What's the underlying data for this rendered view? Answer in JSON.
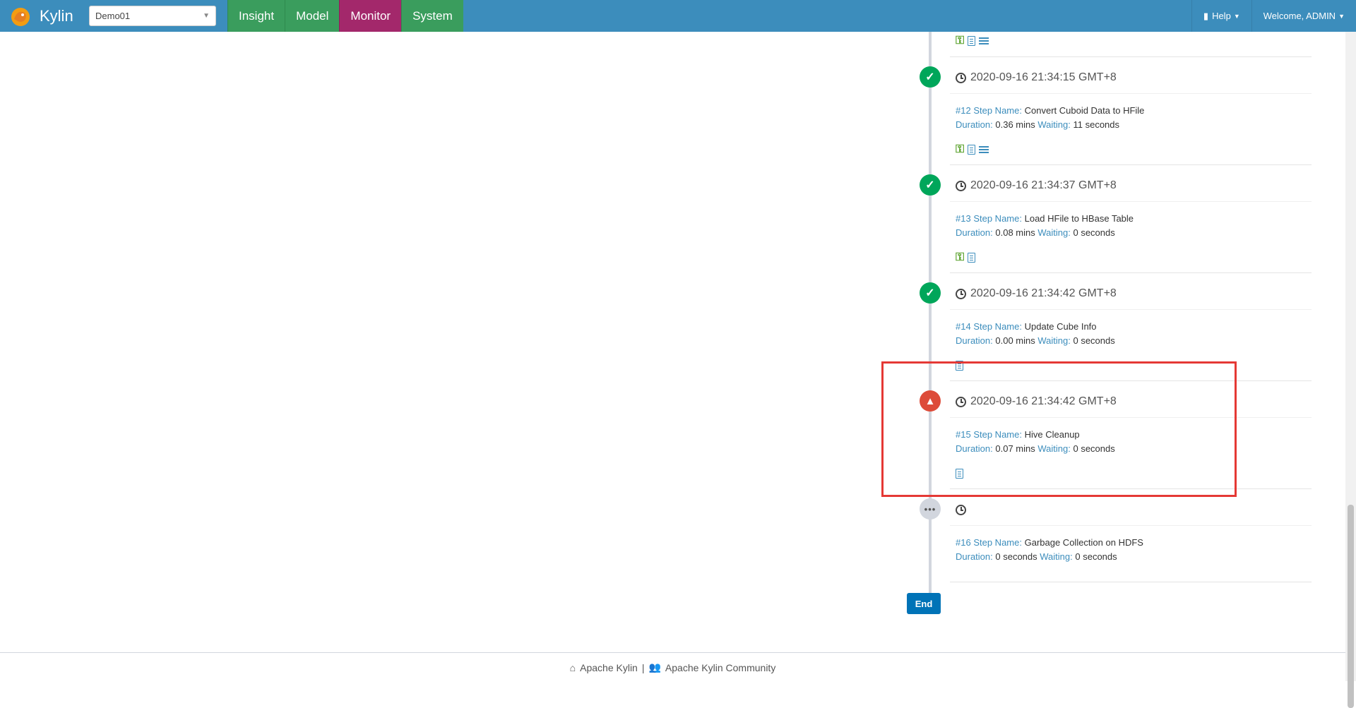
{
  "app": {
    "name": "Kylin"
  },
  "project": {
    "selected": "Demo01"
  },
  "nav": {
    "tabs": [
      {
        "label": "Insight"
      },
      {
        "label": "Model"
      },
      {
        "label": "Monitor"
      },
      {
        "label": "System"
      }
    ],
    "active_tab": "Monitor",
    "help_label": "Help",
    "welcome_label": "Welcome, ADMIN"
  },
  "labels": {
    "step_name": "Step Name:",
    "duration": "Duration:",
    "waiting": "Waiting:"
  },
  "steps": [
    {
      "number": "#12",
      "time": "2020-09-16 21:34:15 GMT+8",
      "name": "Convert Cuboid Data to HFile",
      "duration": "0.36 mins",
      "waiting": "11 seconds",
      "status": "success"
    },
    {
      "number": "#13",
      "time": "2020-09-16 21:34:37 GMT+8",
      "name": "Load HFile to HBase Table",
      "duration": "0.08 mins",
      "waiting": "0 seconds",
      "status": "success"
    },
    {
      "number": "#14",
      "time": "2020-09-16 21:34:42 GMT+8",
      "name": "Update Cube Info",
      "duration": "0.00 mins",
      "waiting": "0 seconds",
      "status": "success"
    },
    {
      "number": "#15",
      "time": "2020-09-16 21:34:42 GMT+8",
      "name": "Hive Cleanup",
      "duration": "0.07 mins",
      "waiting": "0 seconds",
      "status": "error"
    },
    {
      "number": "#16",
      "time": "",
      "name": "Garbage Collection on HDFS",
      "duration": "0 seconds",
      "waiting": "0 seconds",
      "status": "pending"
    }
  ],
  "end_button": "End",
  "footer": {
    "link1": "Apache Kylin",
    "separator": "|",
    "link2": "Apache Kylin Community"
  },
  "colors": {
    "navbar": "#3c8dbc",
    "tab": "#3a9d5d",
    "active_tab": "#a3286b",
    "success": "#00a65a",
    "error": "#dd4b39",
    "highlight": "#e53935"
  }
}
